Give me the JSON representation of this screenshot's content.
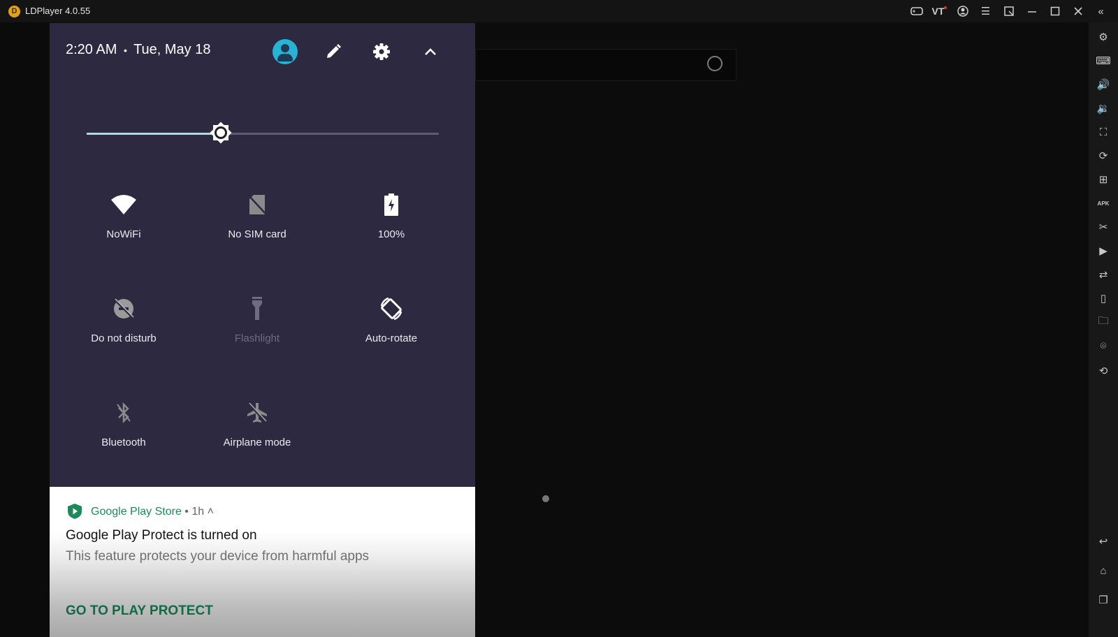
{
  "window": {
    "title": "LDPlayer 4.0.55",
    "titlebar_icons": [
      "gamepad-icon",
      "vt-icon",
      "account-icon",
      "menu-icon",
      "pin-icon",
      "minimize-icon",
      "maximize-icon",
      "close-icon",
      "collapse-sidebar-icon"
    ],
    "vt_label": "VT"
  },
  "sidebar": {
    "top_items": [
      {
        "name": "settings",
        "icon": "gear-icon",
        "glyph": "⚙"
      },
      {
        "name": "keyboard-mapping",
        "icon": "keyboard-icon",
        "glyph": "⌨"
      },
      {
        "name": "volume-up",
        "icon": "volume-up-icon",
        "glyph": "🔊"
      },
      {
        "name": "volume-down",
        "icon": "volume-down-icon",
        "glyph": "🔉"
      },
      {
        "name": "screenshot",
        "icon": "screenshot-icon",
        "glyph": "⛶"
      },
      {
        "name": "record",
        "icon": "record-icon",
        "glyph": "⟳"
      },
      {
        "name": "multi-instance",
        "icon": "add-window-icon",
        "glyph": "⊞"
      },
      {
        "name": "install-apk",
        "icon": "apk-icon",
        "glyph": "APK"
      },
      {
        "name": "scissors",
        "icon": "scissors-icon",
        "glyph": "✂"
      },
      {
        "name": "video",
        "icon": "video-icon",
        "glyph": "▶"
      },
      {
        "name": "sync",
        "icon": "sync-icon",
        "glyph": "⇄"
      },
      {
        "name": "shake",
        "icon": "shake-icon",
        "glyph": "▯"
      },
      {
        "name": "folder",
        "icon": "folder-icon",
        "glyph": "🗀"
      },
      {
        "name": "location",
        "icon": "location-icon",
        "glyph": "⌾"
      },
      {
        "name": "rotate",
        "icon": "rotate-device-icon",
        "glyph": "⟲"
      }
    ],
    "bottom_items": [
      {
        "name": "back",
        "icon": "back-icon",
        "glyph": "↩"
      },
      {
        "name": "home",
        "icon": "home-icon",
        "glyph": "⌂"
      },
      {
        "name": "recents",
        "icon": "recents-icon",
        "glyph": "❐"
      }
    ]
  },
  "quick_settings": {
    "time": "2:20 AM",
    "separator": "•",
    "date": "Tue, May 18",
    "brightness_percent": 38,
    "tiles": [
      {
        "label": "NoWiFi",
        "icon": "wifi-icon",
        "active": true
      },
      {
        "label": "No SIM card",
        "icon": "no-sim-icon",
        "active": true
      },
      {
        "label": "100%",
        "icon": "battery-charging-icon",
        "active": true
      },
      {
        "label": "Do not disturb",
        "icon": "do-not-disturb-off-icon",
        "active": true
      },
      {
        "label": "Flashlight",
        "icon": "flashlight-icon",
        "active": false
      },
      {
        "label": "Auto-rotate",
        "icon": "auto-rotate-icon",
        "active": true
      },
      {
        "label": "Bluetooth",
        "icon": "bluetooth-off-icon",
        "active": true
      },
      {
        "label": "Airplane mode",
        "icon": "airplane-off-icon",
        "active": true
      }
    ]
  },
  "notification": {
    "app": "Google Play Store",
    "meta": " • 1h ˄",
    "title": "Google Play Protect is turned on",
    "body": "This feature protects your device from harmful apps",
    "action": "GO TO PLAY PROTECT",
    "accent": "#1e8a5a"
  }
}
